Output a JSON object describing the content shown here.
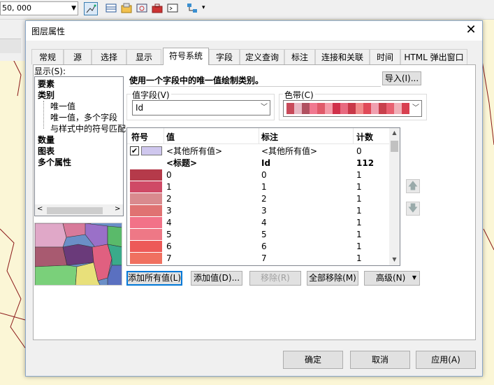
{
  "app": {
    "scale_value": "50, 000"
  },
  "dialog": {
    "title": "图层属性",
    "close_glyph": "✕",
    "tabs": [
      {
        "label": "常规"
      },
      {
        "label": "源"
      },
      {
        "label": "选择"
      },
      {
        "label": "显示"
      },
      {
        "label": "符号系统"
      },
      {
        "label": "字段"
      },
      {
        "label": "定义查询"
      },
      {
        "label": "标注"
      },
      {
        "label": "连接和关联"
      },
      {
        "label": "时间"
      },
      {
        "label": "HTML 弹出窗口"
      }
    ],
    "active_tab": "符号系统",
    "show_label": "显示(S):",
    "tree": {
      "items": [
        {
          "label": "要素",
          "bold": true
        },
        {
          "label": "类别",
          "bold": true
        },
        {
          "label": "唯一值",
          "bold": false
        },
        {
          "label": "唯一值，多个字段",
          "bold": false
        },
        {
          "label": "与样式中的符号匹配",
          "bold": false
        },
        {
          "label": "数量",
          "bold": true
        },
        {
          "label": "图表",
          "bold": true
        },
        {
          "label": "多个属性",
          "bold": true
        }
      ]
    },
    "description": "使用一个字段中的唯一值绘制类别。",
    "import_button": "导入(I)...",
    "value_field": {
      "label": "值字段(V)",
      "value": "Id"
    },
    "color_ramp": {
      "label": "色带(C)",
      "colors": [
        "#c84a5a",
        "#e8b8c4",
        "#b05060",
        "#f07890",
        "#e05a6a",
        "#f49aa8",
        "#d0304a",
        "#e86a80",
        "#c83848",
        "#f08a8a",
        "#e04a58",
        "#f0a0b0",
        "#c8404c",
        "#e86070",
        "#f0b0b8",
        "#d84050"
      ]
    },
    "table": {
      "headers": {
        "symbol": "符号",
        "value": "值",
        "label": "标注",
        "count": "计数"
      },
      "rows": [
        {
          "color": "#cfc7ee",
          "value": "<其他所有值>",
          "label": "<其他所有值>",
          "count": "0",
          "checkbox": true,
          "bold": false
        },
        {
          "color": "",
          "value": "<标题>",
          "label": "Id",
          "count": "112",
          "checkbox": false,
          "bold": true
        },
        {
          "color": "#b53a4a",
          "value": "0",
          "label": "0",
          "count": "1",
          "checkbox": false,
          "bold": false
        },
        {
          "color": "#cf4a66",
          "value": "1",
          "label": "1",
          "count": "1",
          "checkbox": false,
          "bold": false
        },
        {
          "color": "#d98a8e",
          "value": "2",
          "label": "2",
          "count": "1",
          "checkbox": false,
          "bold": false
        },
        {
          "color": "#e07272",
          "value": "3",
          "label": "3",
          "count": "1",
          "checkbox": false,
          "bold": false
        },
        {
          "color": "#f27288",
          "value": "4",
          "label": "4",
          "count": "1",
          "checkbox": false,
          "bold": false
        },
        {
          "color": "#ee7886",
          "value": "5",
          "label": "5",
          "count": "1",
          "checkbox": false,
          "bold": false
        },
        {
          "color": "#ed5a58",
          "value": "6",
          "label": "6",
          "count": "1",
          "checkbox": false,
          "bold": false
        },
        {
          "color": "#f07060",
          "value": "7",
          "label": "7",
          "count": "1",
          "checkbox": false,
          "bold": false
        }
      ]
    },
    "table_buttons": {
      "add_all": "添加所有值(L)",
      "add_values": "添加值(D)...",
      "remove": "移除(R)",
      "remove_all": "全部移除(M)",
      "advanced": "高级(N)"
    },
    "footer": {
      "ok": "确定",
      "cancel": "取消",
      "apply": "应用(A)"
    }
  }
}
